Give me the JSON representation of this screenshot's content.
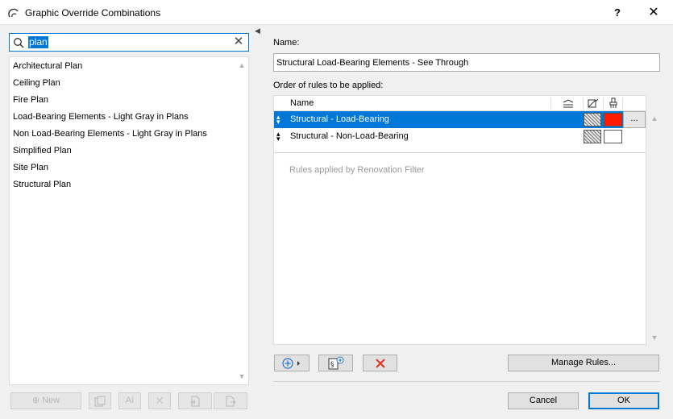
{
  "window": {
    "title": "Graphic Override Combinations",
    "help_label": "?",
    "close_label": "✕"
  },
  "search": {
    "value": "plan",
    "clear_glyph": "✕"
  },
  "combinations": [
    "Architectural Plan",
    "Ceiling Plan",
    "Fire Plan",
    "Load-Bearing Elements - Light Gray in Plans",
    "Non Load-Bearing Elements - Light Gray in Plans",
    "Simplified Plan",
    "Site Plan",
    "Structural Plan"
  ],
  "left_toolbar": {
    "new_label": "New"
  },
  "editor": {
    "name_label": "Name:",
    "name_value": "Structural Load-Bearing Elements - See Through",
    "order_label": "Order of rules to be applied:",
    "table_header_name": "Name",
    "rules": [
      {
        "name": "Structural - Load-Bearing",
        "selected": true,
        "color": "#ff1a00",
        "more_label": "..."
      },
      {
        "name": "Structural - Non-Load-Bearing",
        "selected": false,
        "color": "#ffffff"
      }
    ],
    "renovation_text": "Rules applied by Renovation Filter",
    "manage_rules_label": "Manage Rules..."
  },
  "footer": {
    "cancel_label": "Cancel",
    "ok_label": "OK"
  },
  "colors": {
    "accent": "#0078d7",
    "delete_red": "#e53222"
  }
}
